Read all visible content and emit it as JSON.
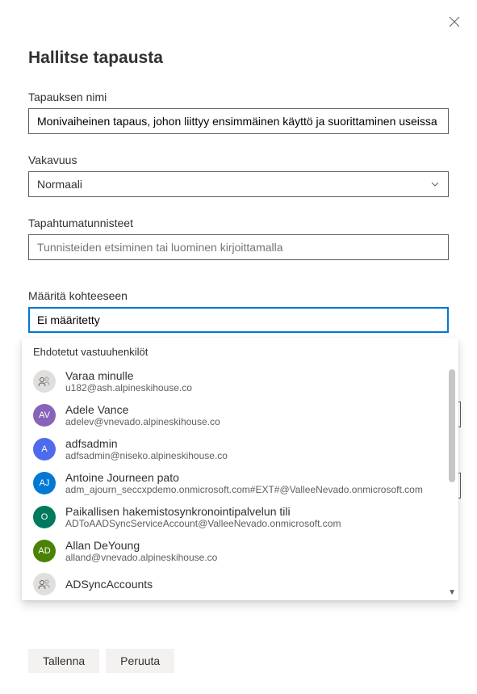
{
  "dialog": {
    "title": "Hallitse tapausta"
  },
  "fields": {
    "incident_name": {
      "label": "Tapauksen nimi",
      "value": "Monivaiheinen tapaus, johon liittyy ensimmäinen käyttö ja suorittaminen useissa päätepisteissä"
    },
    "severity": {
      "label": "Vakavuus",
      "value": "Normaali"
    },
    "tags": {
      "label": "Tapahtumatunnisteet",
      "placeholder": "Tunnisteiden etsiminen tai luominen kirjoittamalla"
    },
    "assign": {
      "label": "Määritä kohteeseen",
      "value": "Ei määritetty"
    }
  },
  "dropdown": {
    "header": "Ehdotetut vastuuhenkilöt",
    "items": [
      {
        "initials_type": "icon",
        "name": "Varaa minulle",
        "email": "u182@ash.alpineskihouse.co"
      },
      {
        "initials": "AV",
        "color": "av",
        "name": "Adele Vance",
        "email": "adelev@vnevado.alpineskihouse.co"
      },
      {
        "initials": "A",
        "color": "a",
        "name": "adfsadmin",
        "email": "adfsadmin@niseko.alpineskihouse.co"
      },
      {
        "initials": "AJ",
        "color": "aj",
        "name": "Antoine Journeen pato",
        "email": "adm_ajourn_seccxpdemo.onmicrosoft.com#EXT#@ValleeNevado.onmicrosoft.com"
      },
      {
        "initials": "O",
        "color": "o",
        "name": "Paikallisen hakemistosynkronointipalvelun tili",
        "email": "ADToAADSyncServiceAccount@ValleeNevado.onmicrosoft.com"
      },
      {
        "initials": "AD",
        "color": "ad",
        "name": "Allan DeYoung",
        "email": "alland@vnevado.alpineskihouse.co"
      },
      {
        "initials_type": "icon",
        "name": "ADSyncAccounts",
        "email": ""
      }
    ]
  },
  "buttons": {
    "save": "Tallenna",
    "cancel": "Peruuta"
  }
}
